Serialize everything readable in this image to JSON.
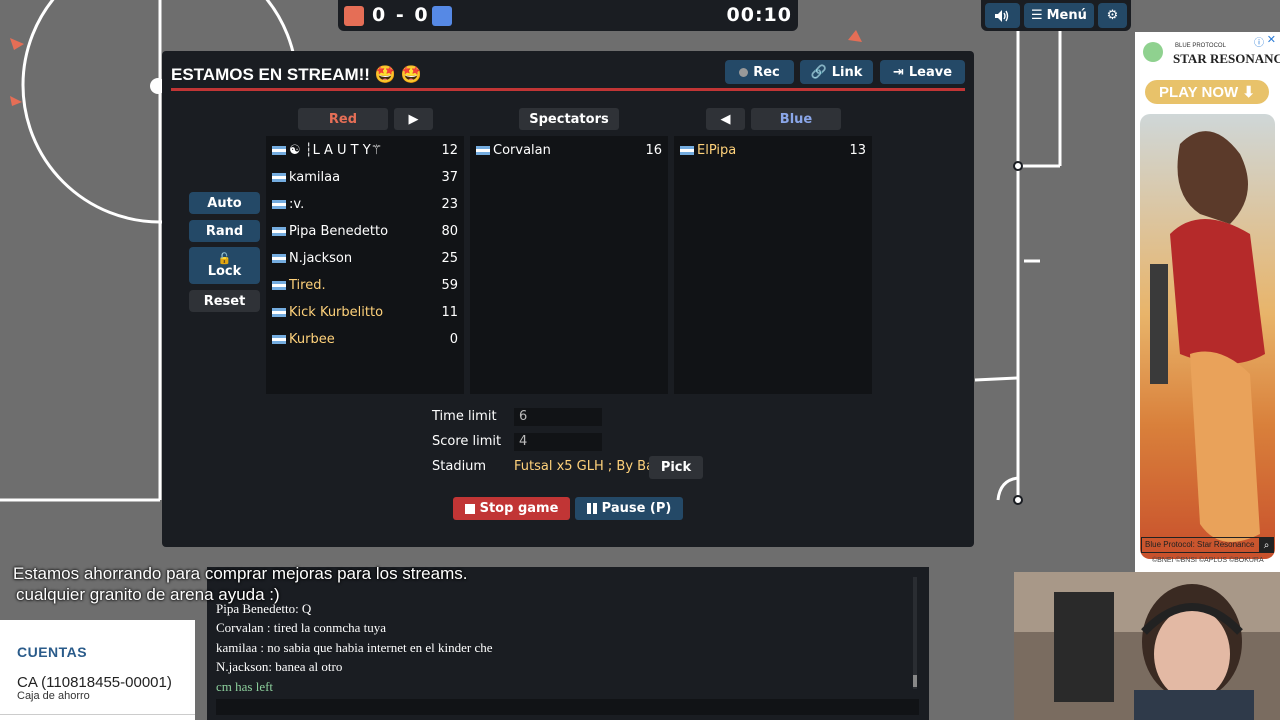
{
  "scoreboard": {
    "score": "0 - 0",
    "time": "00:10",
    "red_color": "#e56e56",
    "blue_color": "#5689e5"
  },
  "topbar": {
    "sound_icon": "speaker-icon",
    "menu_label": "Menú",
    "settings_icon": "gear-icon"
  },
  "room": {
    "title": "ESTAMOS EN STREAM!! 🤩 🤩",
    "rec_label": "Rec",
    "link_label": "Link",
    "leave_label": "Leave",
    "red_label": "Red",
    "spectators_label": "Spectators",
    "blue_label": "Blue",
    "side_buttons": {
      "auto": "Auto",
      "rand": "Rand",
      "lock": "Lock",
      "reset": "Reset"
    },
    "red_players": [
      {
        "name": "☯ ┆L A U T Y⚚",
        "ping": "12"
      },
      {
        "name": "kamilaa",
        "ping": "37"
      },
      {
        "name": ":v.",
        "ping": "23"
      },
      {
        "name": "Pipa Benedetto",
        "ping": "80"
      },
      {
        "name": "N.jackson",
        "ping": "25"
      },
      {
        "name": "Tired.",
        "ping": "59"
      },
      {
        "name": "Kick Kurbelitto",
        "ping": "11"
      },
      {
        "name": "Kurbee",
        "ping": "0"
      }
    ],
    "spectators": [
      {
        "name": "Corvalan",
        "ping": "16"
      }
    ],
    "blue_players": [
      {
        "name": "ElPipa",
        "ping": "13"
      }
    ],
    "time_limit_label": "Time limit",
    "time_limit": "6",
    "score_limit_label": "Score limit",
    "score_limit": "4",
    "stadium_label": "Stadium",
    "stadium": "Futsal x5 GLH ; By Ba...",
    "pick_label": "Pick",
    "stop_label": "Stop game",
    "pause_label": "Pause (P)",
    "accent_color": "#c13535"
  },
  "chat": {
    "messages": [
      "Pipa Benedetto: Q",
      "Corvalan : tired la conmcha tuya",
      "kamilaa : no sabia que habia internet en el kinder che",
      "N.jackson: banea al otro"
    ],
    "notice": "cm has left"
  },
  "overlay": {
    "line1": "Estamos ahorrando para comprar mejoras para los streams.",
    "line2": "cualquier granito de arena ayuda :)"
  },
  "bank": {
    "title": "CUENTAS",
    "account": "CA (110818455-00001)",
    "type": "Caja de ahorro"
  },
  "ad": {
    "logo_small": "BLUE PROTOCOL",
    "logo": "STAR RESONANCE",
    "play": "PLAY NOW ⬇",
    "caption": "Blue Protocol: Star Resonance",
    "copyright": "©BNEI ©BNSI ©APLUS ©BOKURA"
  }
}
